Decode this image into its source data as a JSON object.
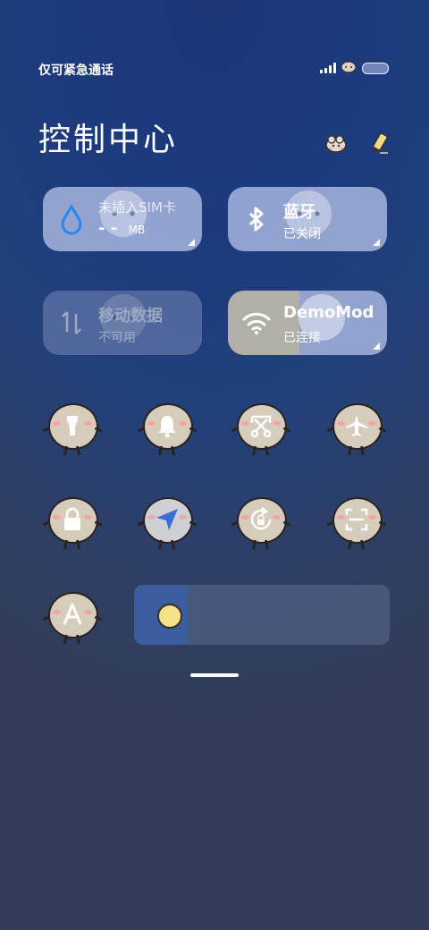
{
  "status_bar": {
    "text": "仅可紧急通话",
    "battery_icon": "battery-icon",
    "signal_icon": "signal-icon"
  },
  "header": {
    "title": "控制中心",
    "left_icon": "sheep-icon",
    "right_icon": "edit-icon"
  },
  "tiles": [
    {
      "name": "mobile-data-usage",
      "icon": "water-drop-icon",
      "title": "未插入SIM卡",
      "value": "- -",
      "unit": "MB",
      "active": true
    },
    {
      "name": "bluetooth",
      "icon": "bluetooth-icon",
      "title": "蓝牙",
      "subtitle": "已关闭",
      "active": true
    },
    {
      "name": "mobile-data",
      "icon": "data-arrows-icon",
      "title": "移动数据",
      "subtitle": "不可用",
      "active": false
    },
    {
      "name": "wifi",
      "icon": "wifi-icon",
      "title": "DemoMod",
      "subtitle": "已连接",
      "active": true
    }
  ],
  "toggles": [
    {
      "name": "flashlight",
      "icon": "flashlight-icon"
    },
    {
      "name": "sound",
      "icon": "bell-icon"
    },
    {
      "name": "screenshot",
      "icon": "scissors-icon"
    },
    {
      "name": "airplane",
      "icon": "airplane-icon"
    },
    {
      "name": "lock-screen",
      "icon": "lock-icon"
    },
    {
      "name": "location",
      "icon": "location-arrow-icon"
    },
    {
      "name": "rotation-lock",
      "icon": "rotation-lock-icon"
    },
    {
      "name": "scanner",
      "icon": "scan-icon"
    },
    {
      "name": "auto-brightness",
      "icon": "letter-a-icon"
    }
  ],
  "brightness": {
    "level": 0.21
  },
  "colors": {
    "tile_active": "#a5b4e0",
    "tile_inactive": "#6e7fa8",
    "icon_blue": "#2b86ea",
    "accent": "#3b5d9f"
  }
}
